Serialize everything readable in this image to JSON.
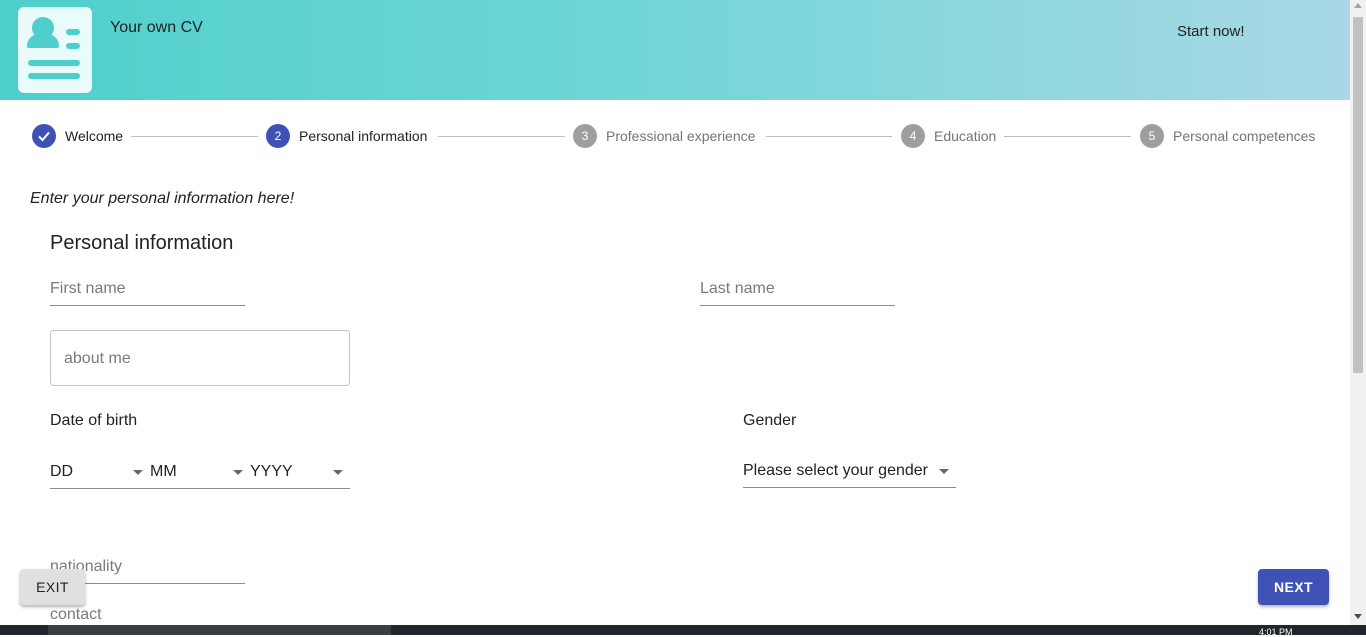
{
  "header": {
    "app_title": "Your own CV",
    "start_label": "Start now!"
  },
  "stepper": {
    "steps": [
      {
        "number": "",
        "label": "Welcome",
        "state": "completed"
      },
      {
        "number": "2",
        "label": "Personal information",
        "state": "active"
      },
      {
        "number": "3",
        "label": "Professional experience",
        "state": "inactive"
      },
      {
        "number": "4",
        "label": "Education",
        "state": "inactive"
      },
      {
        "number": "5",
        "label": "Personal competences",
        "state": "inactive"
      }
    ]
  },
  "form": {
    "intro": "Enter your personal information here!",
    "section_title": "Personal information",
    "first_name_placeholder": "First name",
    "last_name_placeholder": "Last name",
    "about_me_placeholder": "about me",
    "dob_label": "Date of birth",
    "dob_day": "DD",
    "dob_month": "MM",
    "dob_year": "YYYY",
    "gender_label": "Gender",
    "gender_value": "Please select your gender",
    "nationality_placeholder": "nationality",
    "contact_placeholder": "contact"
  },
  "actions": {
    "exit_label": "EXIT",
    "next_label": "NEXT"
  },
  "taskbar": {
    "clock": "4:01 PM"
  },
  "colors": {
    "primary": "#3f51b5",
    "header_gradient_start": "#4ecfcc",
    "header_gradient_end": "#a9d8e6",
    "inactive_step": "#9e9e9e"
  }
}
